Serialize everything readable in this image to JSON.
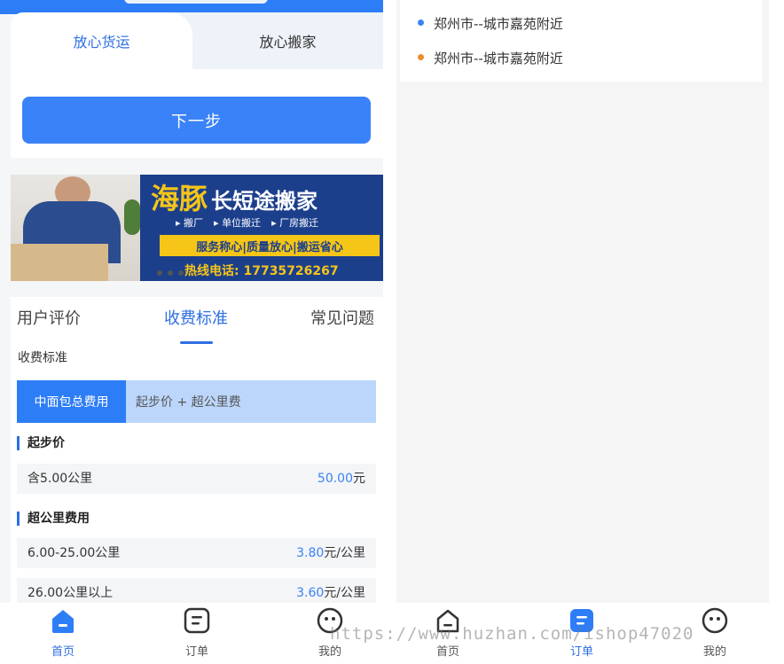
{
  "left": {
    "mode_tabs": [
      {
        "label": "放心货运",
        "active": true
      },
      {
        "label": "放心搬家",
        "active": false
      }
    ],
    "next_button": "下一步",
    "banner": {
      "brand": "海豚",
      "headline": "长短途搬家",
      "services": [
        "搬厂",
        "单位搬迁",
        "厂房搬迁"
      ],
      "slogan": "服务称心|质量放心|搬运省心",
      "hotline": "热线电话: 17735726267"
    },
    "info_tabs": [
      {
        "label": "用户评价",
        "active": false
      },
      {
        "label": "收费标准",
        "active": true
      },
      {
        "label": "常见问题",
        "active": false
      }
    ],
    "section_title": "收费标准",
    "fee_mode": {
      "badge": "中面包总费用",
      "formula": "起步价 + 超公里费"
    },
    "start_price": {
      "title": "起步价",
      "rows": [
        {
          "label": "含5.00公里",
          "value": "50.00",
          "unit": "元"
        }
      ]
    },
    "extra_km": {
      "title": "超公里费用",
      "rows": [
        {
          "label": "6.00-25.00公里",
          "value": "3.80",
          "unit": "元/公里"
        },
        {
          "label": "26.00公里以上",
          "value": "3.60",
          "unit": "元/公里"
        }
      ]
    }
  },
  "right": {
    "addresses": [
      {
        "text": "郑州市--城市嘉苑附近",
        "color": "#3a82f7"
      },
      {
        "text": "郑州市--城市嘉苑附近",
        "color": "#f08c2e"
      }
    ]
  },
  "tabbar_left": [
    {
      "label": "首页",
      "icon": "home-icon",
      "active": true
    },
    {
      "label": "订单",
      "icon": "order-icon",
      "active": false
    },
    {
      "label": "我的",
      "icon": "profile-icon",
      "active": false
    }
  ],
  "tabbar_right": [
    {
      "label": "首页",
      "icon": "home-icon",
      "active": false
    },
    {
      "label": "订单",
      "icon": "order-icon",
      "active": true
    },
    {
      "label": "我的",
      "icon": "profile-icon",
      "active": false
    }
  ],
  "watermark": "https://www.huzhan.com/ishop47020",
  "colors": {
    "accent": "#2d7df6",
    "accent_light": "#bcd6fb",
    "price": "#3a82f7"
  }
}
